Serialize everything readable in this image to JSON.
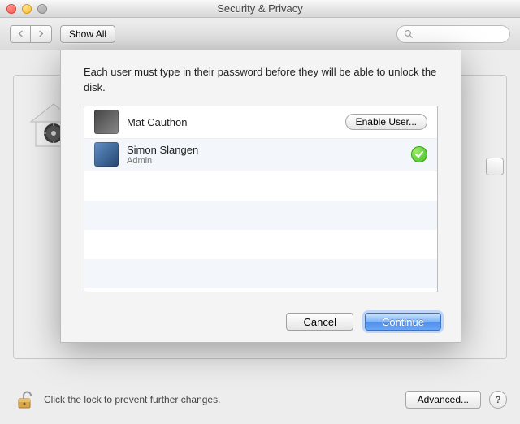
{
  "window": {
    "title": "Security & Privacy"
  },
  "toolbar": {
    "show_all": "Show All",
    "search_placeholder": ""
  },
  "sheet": {
    "message": "Each user must type in their password before they will be able to unlock the disk.",
    "users": [
      {
        "name": "Mat Cauthon",
        "role": "",
        "action_label": "Enable User...",
        "enabled": false
      },
      {
        "name": "Simon Slangen",
        "role": "Admin",
        "action_label": "",
        "enabled": true
      }
    ],
    "buttons": {
      "cancel": "Cancel",
      "continue": "Continue"
    }
  },
  "footer": {
    "lock_text": "Click the lock to prevent further changes.",
    "advanced": "Advanced...",
    "help": "?"
  }
}
